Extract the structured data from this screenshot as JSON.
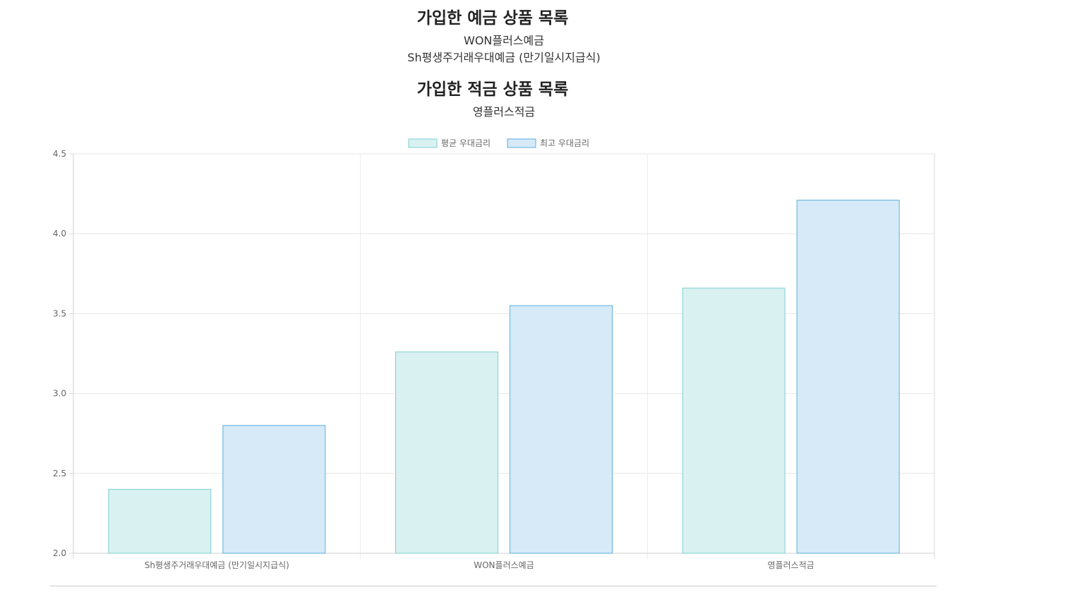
{
  "deposit_section": {
    "title": "가입한 예금 상품 목록",
    "products": [
      "WON플러스예금",
      "Sh평생주거래우대예금 (만기일시지급식)"
    ]
  },
  "savings_section": {
    "title": "가입한 적금 상품 목록",
    "products": [
      "영플러스적금"
    ]
  },
  "chart_data": {
    "type": "bar",
    "categories": [
      "Sh평생주거래우대예금 (만기일시지급식)",
      "WON플러스예금",
      "영플러스적금"
    ],
    "series": [
      {
        "name": "평균 우대금리",
        "values": [
          2.4,
          3.26,
          3.66
        ],
        "fill": "#d9f1f1",
        "stroke": "#7fcfcf"
      },
      {
        "name": "최고 우대금리",
        "values": [
          2.8,
          3.55,
          4.21
        ],
        "fill": "#d6eaf8",
        "stroke": "#5aaee0"
      }
    ],
    "ylim": [
      2.0,
      4.5
    ],
    "yticks": [
      "2.0",
      "2.5",
      "3.0",
      "3.5",
      "4.0",
      "4.5"
    ],
    "ytick_values": [
      2.0,
      2.5,
      3.0,
      3.5,
      4.0,
      4.5
    ],
    "grid": true,
    "legend_position": "top-center"
  }
}
